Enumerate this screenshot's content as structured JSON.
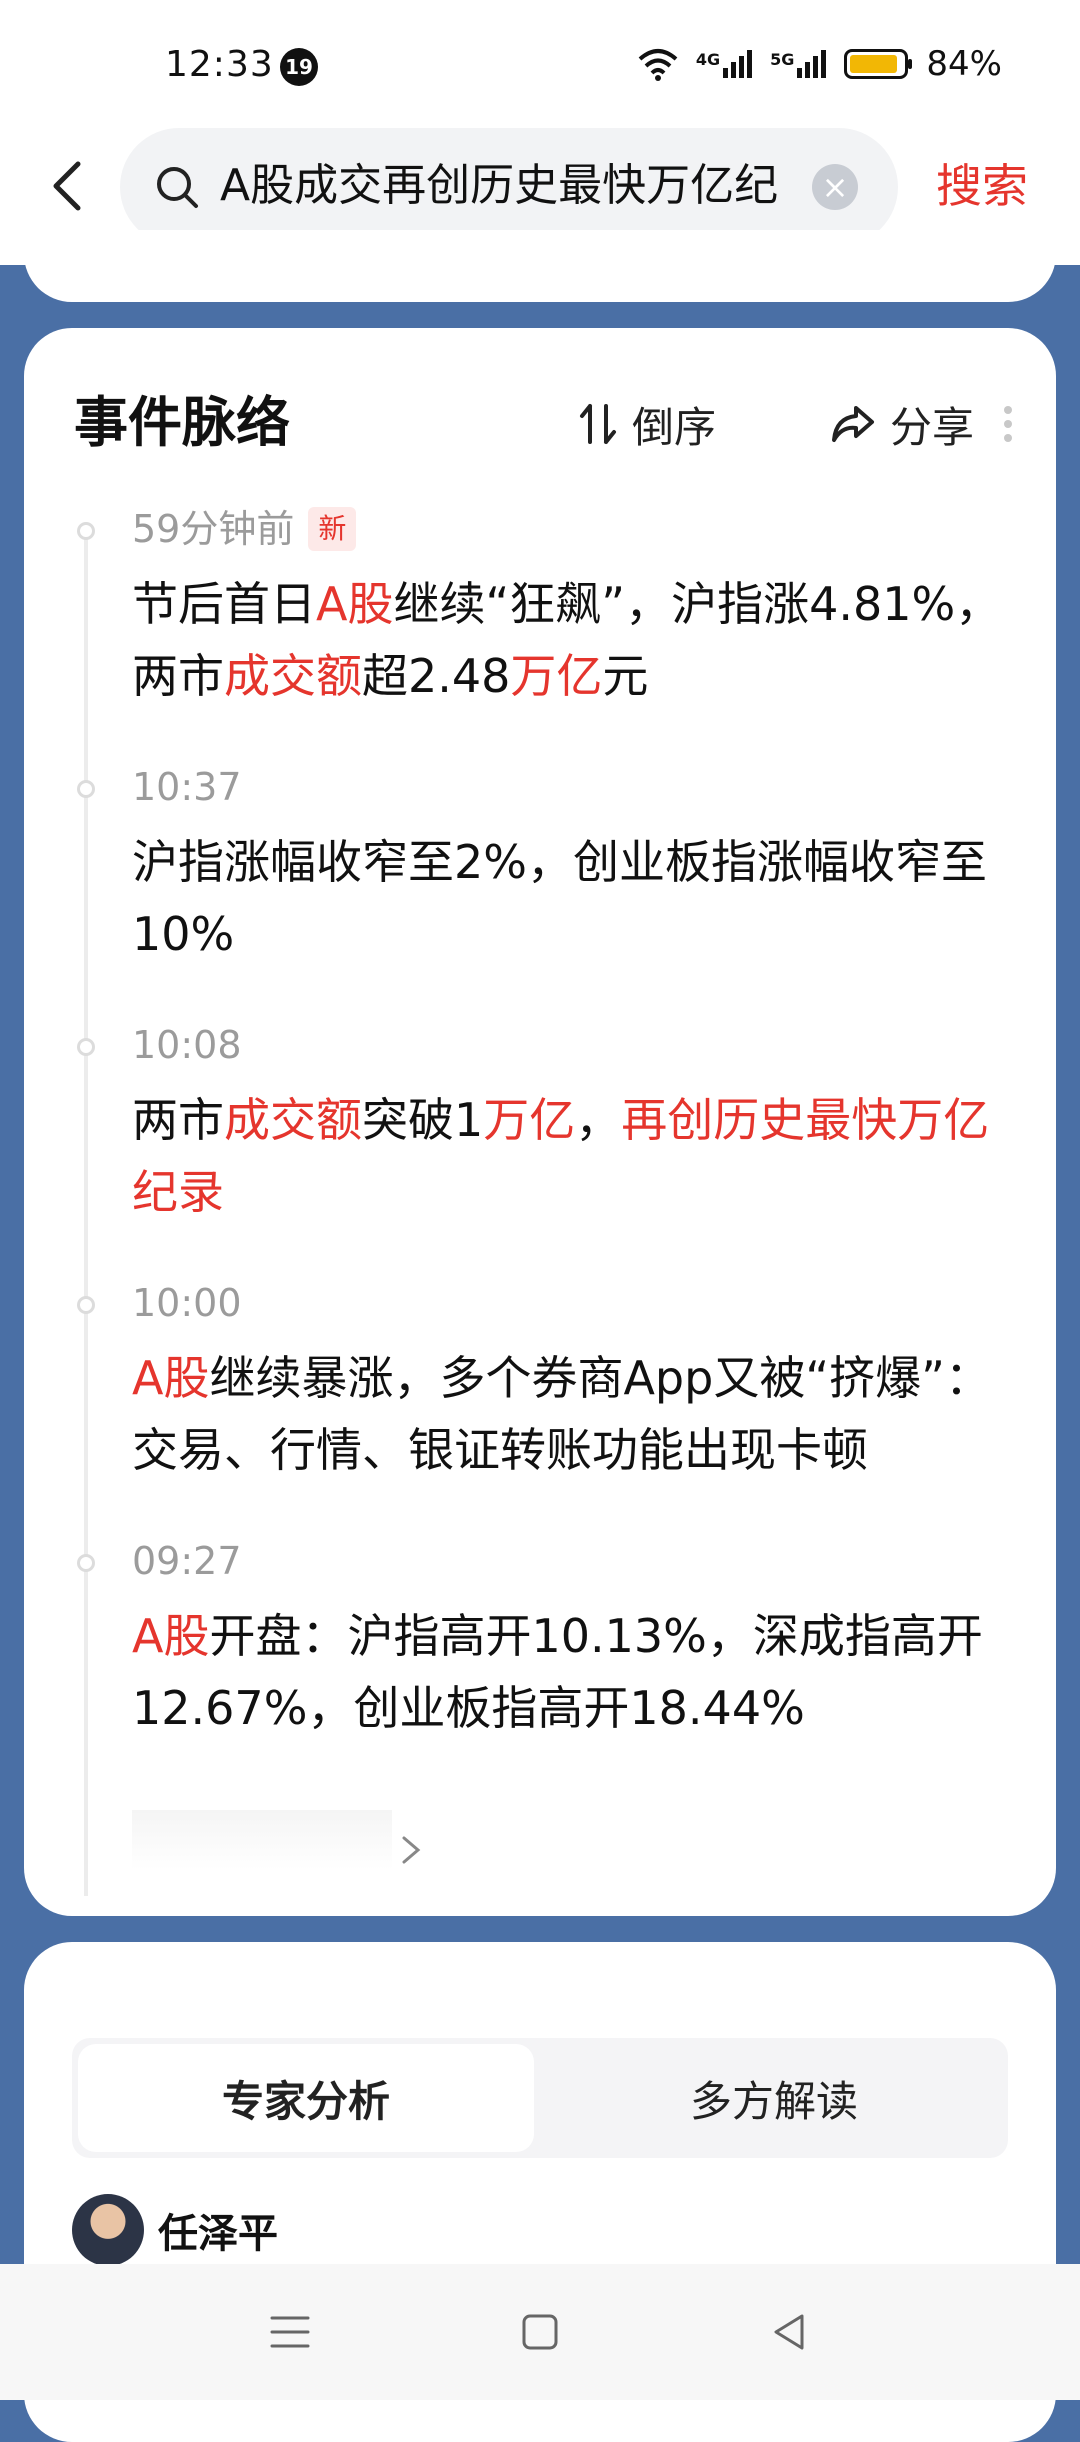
{
  "status_bar": {
    "time": "12:33",
    "notification_count": "19",
    "network_4g": "4G",
    "network_5g": "5G",
    "battery_percent": "84%"
  },
  "search": {
    "query": "A股成交再创历史最快万亿纪",
    "button_label": "搜索"
  },
  "event_card": {
    "title": "事件脉络",
    "sort_label": "倒序",
    "share_label": "分享",
    "items": [
      {
        "time": "59分钟前",
        "badge": "新",
        "segments": [
          {
            "t": "节后首日",
            "r": false
          },
          {
            "t": "A股",
            "r": true
          },
          {
            "t": "继续“狂飙”，沪指涨4.81%，两市",
            "r": false
          },
          {
            "t": "成交额",
            "r": true
          },
          {
            "t": "超2.48",
            "r": false
          },
          {
            "t": "万亿",
            "r": true
          },
          {
            "t": "元",
            "r": false
          }
        ]
      },
      {
        "time": "10:37",
        "segments": [
          {
            "t": "沪指涨幅收窄至2%，创业板指涨幅收窄至10%",
            "r": false
          }
        ]
      },
      {
        "time": "10:08",
        "segments": [
          {
            "t": "两市",
            "r": false
          },
          {
            "t": "成交额",
            "r": true
          },
          {
            "t": "突破1",
            "r": false
          },
          {
            "t": "万亿",
            "r": true
          },
          {
            "t": "，",
            "r": false
          },
          {
            "t": "再创历史最快万亿纪录",
            "r": true
          }
        ]
      },
      {
        "time": "10:00",
        "segments": [
          {
            "t": "A股",
            "r": true
          },
          {
            "t": "继续暴涨，多个券商App又被“挤爆”：交易、行情、银证转账功能出现卡顿",
            "r": false
          }
        ]
      },
      {
        "time": "09:27",
        "segments": [
          {
            "t": "A股",
            "r": true
          },
          {
            "t": "开盘：沪指高开10.13%，深成指高开12.67%，创业板指高开18.44%",
            "r": false
          }
        ]
      }
    ]
  },
  "analysis": {
    "tabs": [
      "专家分析",
      "多方解读"
    ],
    "expert_name": "任泽平"
  },
  "colors": {
    "accent_red": "#e5352d",
    "page_background": "#4a6fa5"
  }
}
